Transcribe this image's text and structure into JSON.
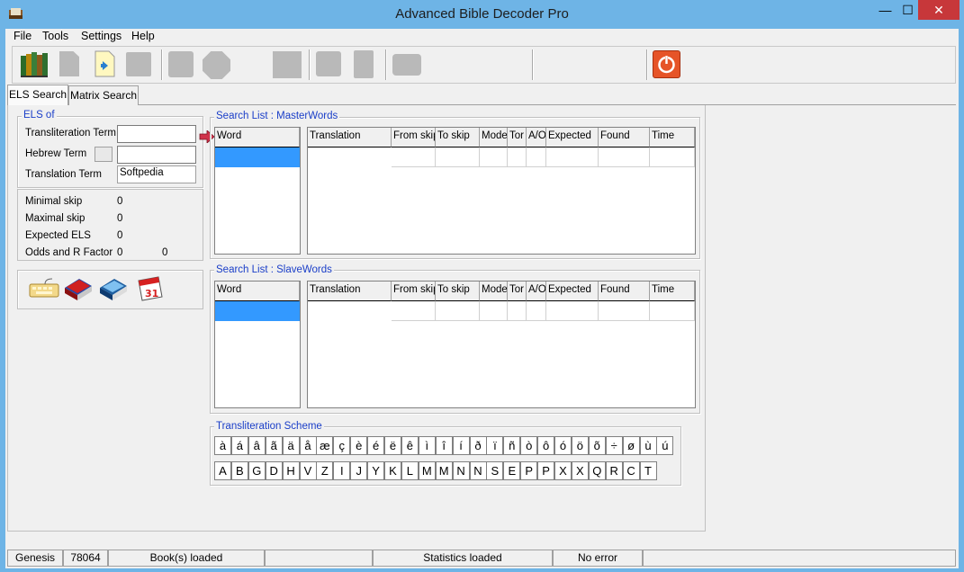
{
  "window": {
    "title": "Advanced Bible Decoder Pro"
  },
  "menu": [
    "File",
    "Tools",
    "Settings",
    "Help"
  ],
  "tabs": {
    "els_search": "ELS Search",
    "matrix_search": "Matrix Search"
  },
  "els_of": {
    "legend": "ELS of",
    "transliteration_label": "Transliteration Term",
    "transliteration_value": "",
    "hebrew_label": "Hebrew Term",
    "hebrew_value": "",
    "translation_label": "Translation Term",
    "translation_value": "Softpedia"
  },
  "stats": {
    "minimal_skip_label": "Minimal skip",
    "minimal_skip": "0",
    "maximal_skip_label": "Maximal skip",
    "maximal_skip": "0",
    "expected_els_label": "Expected ELS",
    "expected_els": "0",
    "odds_label": "Odds and R Factor",
    "odds": "0",
    "r_factor": "0"
  },
  "search_master": {
    "legend": "Search List : MasterWords",
    "word_header": "Word",
    "columns": [
      "Translation",
      "From skip",
      "To skip",
      "Mode",
      "Tor",
      "A/O",
      "Expected",
      "Found",
      "Time"
    ]
  },
  "search_slave": {
    "legend": "Search List : SlaveWords",
    "word_header": "Word",
    "columns": [
      "Translation",
      "From skip",
      "To skip",
      "Mode",
      "Tor",
      "A/O",
      "Expected",
      "Found",
      "Time"
    ]
  },
  "transliteration": {
    "legend": "Transliteration Scheme",
    "row1": [
      "à",
      "á",
      "â",
      "ã",
      "ä",
      "å",
      "æ",
      "ç",
      "è",
      "é",
      "ë",
      "ê",
      "ì",
      "î",
      "í",
      "ð",
      "ï",
      "ñ",
      "ò",
      "ô",
      "ó",
      "ö",
      "õ",
      "÷",
      "ø",
      "ù",
      "ú"
    ],
    "row2": [
      "A",
      "B",
      "G",
      "D",
      "H",
      "V",
      "Z",
      "I",
      "J",
      "Y",
      "K",
      "L",
      "M",
      "M",
      "N",
      "N",
      "S",
      "E",
      "P",
      "P",
      "X",
      "X",
      "Q",
      "R",
      "C",
      "T"
    ]
  },
  "status": {
    "book": "Genesis",
    "count": "78064",
    "books_loaded": "Book(s) loaded",
    "panel4": "",
    "statistics": "Statistics loaded",
    "error": "No error",
    "panel7": ""
  },
  "colors": {
    "title_bar": "#6eb4e6",
    "close": "#c7373a",
    "selection": "#3399ff",
    "legend": "#1a3ec8",
    "power_button": "#e65428"
  }
}
